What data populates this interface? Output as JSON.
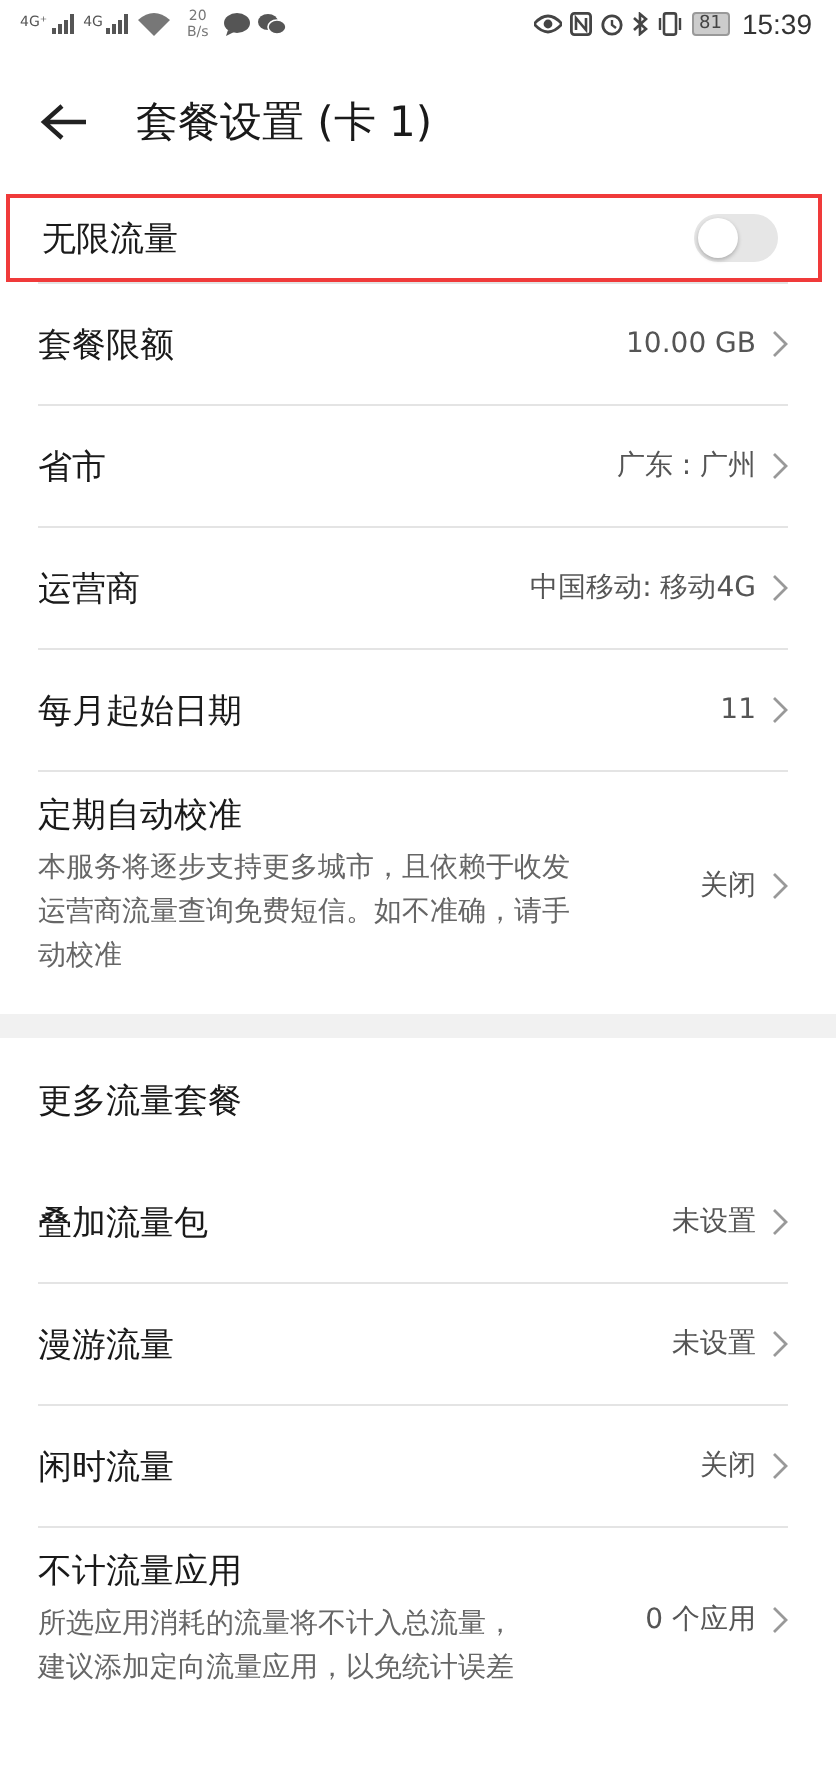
{
  "status_bar": {
    "signals": [
      "4G⁺",
      "4G"
    ],
    "speed": "20",
    "speed_unit": "B/s",
    "battery": "81",
    "time": "15:39"
  },
  "header": {
    "title": "套餐设置 (卡 1)"
  },
  "sections": [
    {
      "items": [
        {
          "kind": "toggle",
          "label": "无限流量",
          "on": false,
          "highlighted": true
        },
        {
          "kind": "value",
          "label": "套餐限额",
          "value": "10.00 GB"
        },
        {
          "kind": "value",
          "label": "省市",
          "value": "广东 : 广州"
        },
        {
          "kind": "value",
          "label": "运营商",
          "value": "中国移动: 移动4G"
        },
        {
          "kind": "value",
          "label": "每月起始日期",
          "value": "11"
        },
        {
          "kind": "detail",
          "label": "定期自动校准",
          "description": "本服务将逐步支持更多城市，且依赖于收发运营商流量查询免费短信。如不准确，请手动校准",
          "value": "关闭"
        }
      ]
    },
    {
      "title": "更多流量套餐",
      "items": [
        {
          "kind": "value",
          "label": "叠加流量包",
          "value": "未设置"
        },
        {
          "kind": "value",
          "label": "漫游流量",
          "value": "未设置"
        },
        {
          "kind": "value",
          "label": "闲时流量",
          "value": "关闭"
        },
        {
          "kind": "detail",
          "label": "不计流量应用",
          "description": "所选应用消耗的流量将不计入总流量，建议添加定向流量应用，以免统计误差",
          "value": "0 个应用"
        }
      ]
    }
  ]
}
